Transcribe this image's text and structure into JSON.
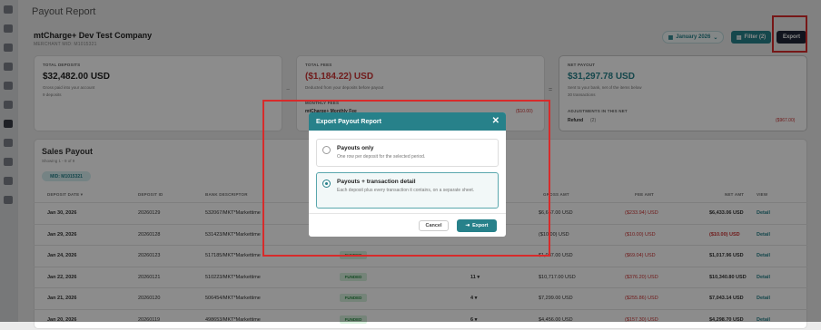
{
  "page": {
    "title": "Payout Report"
  },
  "merchant": {
    "name": "mtCharge+ Dev Test Company",
    "mid_line": "MERCHANT MID: M1015321"
  },
  "toolbar": {
    "date_label": "January 2026",
    "filter_label": "Filter (2)",
    "export_label": "Export"
  },
  "summary": {
    "deposit": {
      "label": "TOTAL DEPOSITS",
      "value": "$32,482.00 USD",
      "desc": "Gross paid into your account",
      "count": "9 deposits"
    },
    "fees": {
      "label": "TOTAL FEES",
      "value": "($1,184.22) USD",
      "desc": "Deducted from your deposits before payout",
      "col_right": "MONTHLY FEES",
      "item": "mtCharge+ Monthly Fee",
      "item_value": "($10.00)"
    },
    "net": {
      "label": "NET PAYOUT",
      "value": "$31,297.78 USD",
      "desc": "Sent to your bank, net of the items below",
      "count": "30 transactions",
      "adj_label": "ADJUSTMENTS IN THIS NET",
      "adj_item": "Refund",
      "adj_count": "(2)",
      "adj_value": "($967.00)"
    }
  },
  "sales": {
    "title": "Sales Payout",
    "subtitle": "Showing 1 - 9 of 9",
    "mid_pill": "MID: M1015321"
  },
  "table": {
    "headers": {
      "date": "DEPOSIT DATE",
      "id": "DEPOSIT ID",
      "desc": "BANK DESCRIPTOR",
      "gross": "GROSS AMT",
      "fee": "FEE AMT",
      "net": "NET AMT",
      "view": "VIEW"
    },
    "rows": [
      {
        "date": "Jan 30, 2026",
        "id": "20260129",
        "desc": "532067/MKT*Markettime",
        "status": "",
        "count": "",
        "gross": "$6,667.00 USD",
        "fee": "($233.94) USD",
        "net": "$6,433.06 USD",
        "view": "Detail"
      },
      {
        "date": "Jan 29, 2026",
        "id": "20260128",
        "desc": "531423/MKT*Markettime",
        "status": "",
        "count": "",
        "gross": "($10.00) USD",
        "fee": "($10.00) USD",
        "net": "($10.00) USD",
        "view": "Detail"
      },
      {
        "date": "Jan 24, 2026",
        "id": "20260123",
        "desc": "517185/MKT*Markettime",
        "status": "FUNDED",
        "count": "",
        "gross": "$1,087.00 USD",
        "fee": "($69.04) USD",
        "net": "$1,017.96 USD",
        "view": "Detail"
      },
      {
        "date": "Jan 22, 2026",
        "id": "20260121",
        "desc": "510223/MKT*Markettime",
        "status": "FUNDED",
        "count": "11 ▾",
        "gross": "$10,717.00 USD",
        "fee": "($376.20) USD",
        "net": "$10,340.80 USD",
        "view": "Detail"
      },
      {
        "date": "Jan 21, 2026",
        "id": "20260120",
        "desc": "506454/MKT*Markettime",
        "status": "FUNDED",
        "count": "4 ▾",
        "gross": "$7,299.00 USD",
        "fee": "($255.86) USD",
        "net": "$7,043.14 USD",
        "view": "Detail"
      },
      {
        "date": "Jan 20, 2026",
        "id": "20260119",
        "desc": "498653/MKT*Markettime",
        "status": "FUNDED",
        "count": "6 ▾",
        "gross": "$4,456.00 USD",
        "fee": "($157.30) USD",
        "net": "$4,298.70 USD",
        "view": "Detail"
      }
    ]
  },
  "modal": {
    "title": "Export Payout Report",
    "close_glyph": "✕",
    "option1": {
      "title": "Payouts only",
      "desc": "One row per deposit for the selected period."
    },
    "option2": {
      "title": "Payouts + transaction detail",
      "desc": "Each deposit plus every transaction it contains, on a separate sheet."
    },
    "cancel_label": "Cancel",
    "export_label": "Export"
  },
  "icons": {
    "calendar": "calendar-icon",
    "filter": "filter-icon",
    "export": "export-icon",
    "close": "close-icon"
  },
  "colors": {
    "accent": "#27818a",
    "danger": "#c33333",
    "highlight": "#d72b2b",
    "dark_button": "#1f2537"
  }
}
